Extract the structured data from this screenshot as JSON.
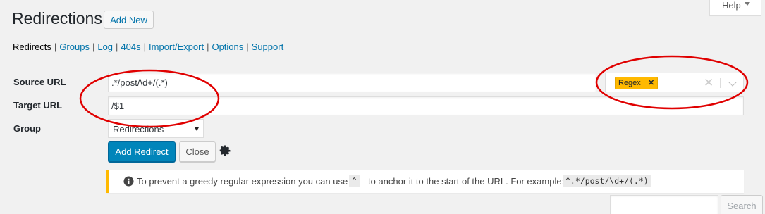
{
  "help": {
    "label": "Help"
  },
  "header": {
    "title": "Redirections",
    "add_new_label": "Add New"
  },
  "subnav": {
    "current": "Redirects",
    "links": [
      "Groups",
      "Log",
      "404s",
      "Import/Export",
      "Options",
      "Support"
    ]
  },
  "form": {
    "source_label": "Source URL",
    "source_value": ".*/post/\\d+/(.*)",
    "target_label": "Target URL",
    "target_value": "/$1",
    "group_label": "Group",
    "group_value": "Redirections",
    "regex_tag": "Regex",
    "add_button": "Add Redirect",
    "close_button": "Close"
  },
  "notice": {
    "text_before": "To prevent a greedy regular expression you can use",
    "code_caret": "^",
    "text_middle": "to anchor it to the start of the URL. For example:",
    "code_example": "^.*/post/\\d+/(.*)"
  },
  "search": {
    "button_label": "Search",
    "value": ""
  },
  "colors": {
    "primary": "#0085ba",
    "link": "#0073aa",
    "warning": "#ffb900",
    "annotation": "#e00000"
  }
}
